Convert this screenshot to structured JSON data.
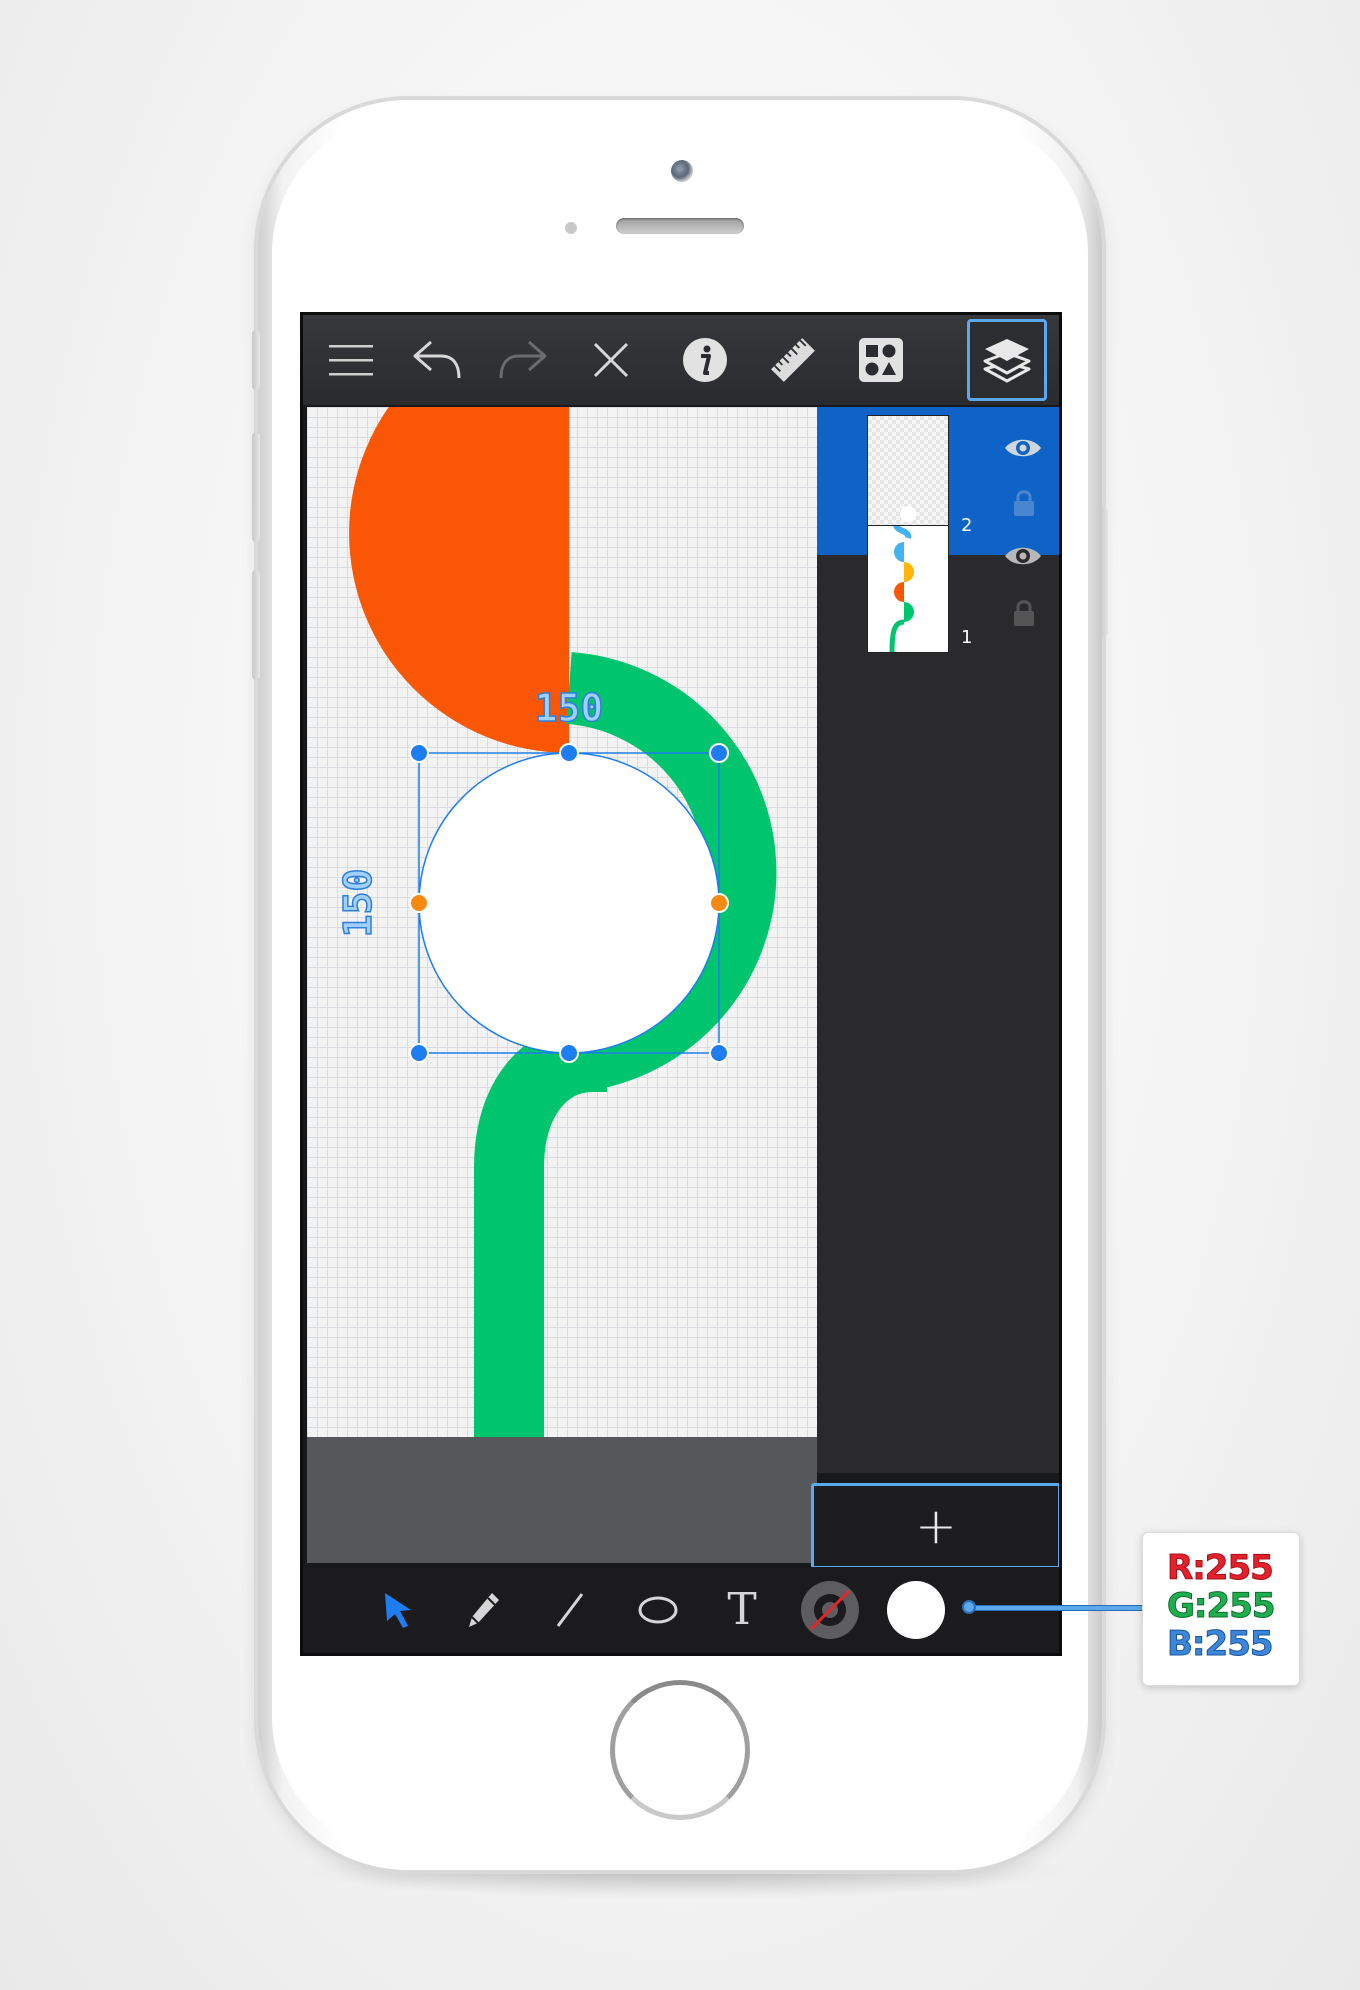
{
  "toolbar": {
    "icons": [
      "menu-icon",
      "undo-icon",
      "redo-icon",
      "close-icon",
      "info-icon",
      "ruler-icon",
      "library-icon",
      "layers-icon"
    ]
  },
  "canvas": {
    "dimension_width_label": "150",
    "dimension_height_label": "150",
    "colors": {
      "orange_shape": "#F95705",
      "green_path": "#00C56E",
      "white_circle": "#FFFFFF",
      "selection": "#1E7DF0",
      "midpoint_handle": "#F48A12"
    }
  },
  "layers": [
    {
      "number": "2",
      "selected": true,
      "visible": true,
      "locked": false
    },
    {
      "number": "1",
      "selected": false,
      "visible": true,
      "locked": false
    }
  ],
  "layers_panel": {
    "add_label": "+",
    "selected_color": "#0F63C7"
  },
  "bottom_tools": {
    "icons": [
      "select-arrow-icon",
      "pencil-icon",
      "line-icon",
      "ellipse-icon",
      "text-icon",
      "stroke-color-icon",
      "fill-color-icon"
    ],
    "text_tool_label": "T",
    "active_tool": "select",
    "fill_color": "#FFFFFF"
  },
  "rgb_callout": {
    "r_label": "R",
    "r_value": "255",
    "g_label": "G",
    "g_value": "255",
    "b_label": "B",
    "b_value": "255",
    "separator": ":"
  }
}
